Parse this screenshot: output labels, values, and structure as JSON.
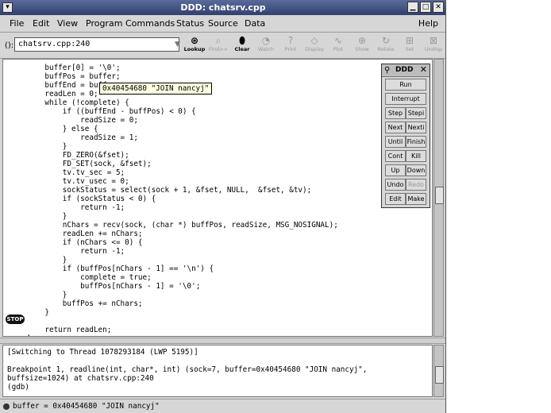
{
  "window": {
    "title": "DDD: chatsrv.cpp"
  },
  "menu": [
    "File",
    "Edit",
    "View",
    "Program",
    "Commands",
    "Status",
    "Source",
    "Data"
  ],
  "help_label": "Help",
  "toolbar": {
    "arg_label": "():",
    "arg_value": "chatsrv.cpp:240",
    "buttons": [
      {
        "label": "Lookup",
        "icon": "lookup-icon",
        "enabled": true
      },
      {
        "label": "Find>>",
        "icon": "find-icon",
        "enabled": false
      },
      {
        "label": "Clear",
        "icon": "clear-icon",
        "enabled": true
      },
      {
        "label": "Watch",
        "icon": "watch-icon",
        "enabled": false
      },
      {
        "label": "Print",
        "icon": "print-icon",
        "enabled": false
      },
      {
        "label": "Display",
        "icon": "display-icon",
        "enabled": false
      },
      {
        "label": "Plot",
        "icon": "plot-icon",
        "enabled": false
      },
      {
        "label": "Show",
        "icon": "show-icon",
        "enabled": false
      },
      {
        "label": "Rotate",
        "icon": "rotate-icon",
        "enabled": false
      },
      {
        "label": "Set",
        "icon": "set-icon",
        "enabled": false
      },
      {
        "label": "Undisp",
        "icon": "undisp-icon",
        "enabled": false
      }
    ]
  },
  "source_lines": [
    "    buffer[0] = '\\0';",
    "    buffPos = buffer;",
    "    buffEnd = buffer",
    "    readLen = 0;",
    "    while (!complete) {",
    "        if ((buffEnd - buffPos) < 0) {",
    "            readSize = 0;",
    "        } else {",
    "            readSize = 1;",
    "        }",
    "        FD_ZERO(&fset);",
    "        FD_SET(sock, &fset);",
    "        tv.tv_sec = 5;",
    "        tv.tv_usec = 0;",
    "        sockStatus = select(sock + 1, &fset, NULL,  &fset, &tv);",
    "        if (sockStatus < 0) {",
    "            return -1;",
    "        }",
    "        nChars = recv(sock, (char *) buffPos, readSize, MSG_NOSIGNAL);",
    "        readLen += nChars;",
    "        if (nChars <= 0) {",
    "            return -1;",
    "        }",
    "        if (buffPos[nChars - 1] == '\\n') {",
    "            complete = true;",
    "            buffPos[nChars - 1] = '\\0';",
    "        }",
    "        buffPos += nChars;",
    "    }",
    "",
    "    return readLen;",
    "}"
  ],
  "stop_marker": {
    "label": "STOP",
    "line": 30
  },
  "tooltip": "0x40454680 \"JOIN nancyj\"",
  "console_lines": [
    "[Switching to Thread 1078293184 (LWP 5195)]",
    "",
    "Breakpoint 1, readline(int, char*, int) (sock=7, buffer=0x40454680 \"JOIN nancyj\",",
    "buffsize=1024) at chatsrv.cpp:240",
    "(gdb) "
  ],
  "status": "buffer = 0x40454680 \"JOIN nancyj\"",
  "command_tool": {
    "title": "DDD",
    "run": "Run",
    "interrupt": "Interrupt",
    "pairs": [
      {
        "l": "Step",
        "r": "Stepi",
        "l_en": true,
        "r_en": true
      },
      {
        "l": "Next",
        "r": "Nexti",
        "l_en": true,
        "r_en": true
      },
      {
        "l": "Until",
        "r": "Finish",
        "l_en": true,
        "r_en": true
      },
      {
        "l": "Cont",
        "r": "Kill",
        "l_en": true,
        "r_en": true
      },
      {
        "l": "Up",
        "r": "Down",
        "l_en": true,
        "r_en": true
      },
      {
        "l": "Undo",
        "r": "Redo",
        "l_en": true,
        "r_en": false
      },
      {
        "l": "Edit",
        "r": "Make",
        "l_en": true,
        "r_en": true
      }
    ]
  }
}
